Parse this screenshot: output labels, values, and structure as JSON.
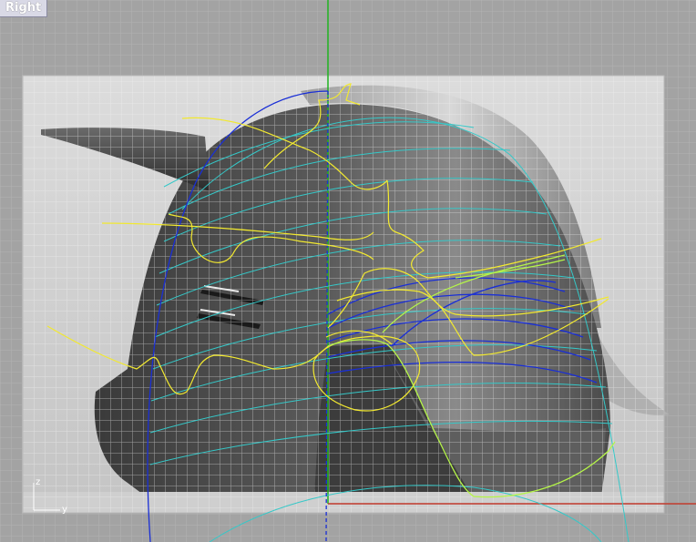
{
  "viewport": {
    "title": "Right",
    "axis_icon": {
      "vertical_label": "z",
      "horizontal_label": "y"
    }
  },
  "colors": {
    "background": "#a3a3a3",
    "grid_minor": "#b8b8b8",
    "grid_major": "#8c8c8c",
    "green_axis": "#21b321",
    "red_axis": "#c0392b",
    "curve_yellow": "#f2e930",
    "curve_cyan": "#35c8c8",
    "curve_blue": "#1a2fd6",
    "curve_lime": "#b5f548"
  },
  "icons": {
    "reference_image": "helmet-photo",
    "axis_indicator": "zy-axis-icon"
  }
}
